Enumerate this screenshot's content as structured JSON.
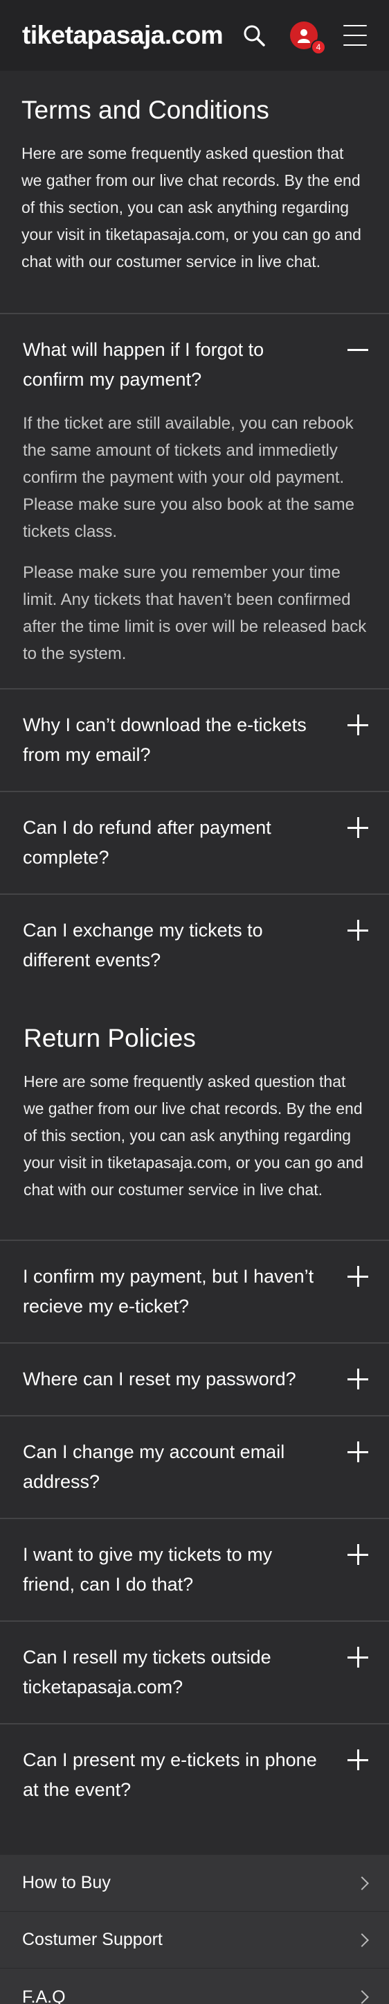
{
  "header": {
    "logo": "tiketapasaja.com",
    "notification_count": "4",
    "icons": {
      "search": "search-icon",
      "avatar": "user-avatar-icon",
      "menu": "hamburger-menu-icon"
    }
  },
  "terms": {
    "title": "Terms and Conditions",
    "description": "Here are some frequently asked question that we gather from our live chat records. By the end of this section, you can ask anything regarding your visit in tiketapasaja.com, or you can go and chat with our costumer service in live chat.",
    "faqs": [
      {
        "question": "What will happen if I forgot to confirm my payment?",
        "expanded": true,
        "answer": [
          "If the ticket are still available, you can rebook the same amount of tickets and immedietly confirm the payment with your old payment. Please make sure you also book at the same tickets class.",
          "Please make sure you remember your time limit. Any tickets that haven’t been confirmed after the time limit is over will be released back to the system."
        ]
      },
      {
        "question": "Why I can’t download the e-tickets from my email?",
        "expanded": false
      },
      {
        "question": "Can I do refund after payment complete?",
        "expanded": false
      },
      {
        "question": "Can I exchange my tickets to different events?",
        "expanded": false
      }
    ]
  },
  "returns": {
    "title": "Return Policies",
    "description": "Here are some frequently asked question that we gather from our live chat records. By the end of this section, you can ask anything regarding your visit in tiketapasaja.com, or you can go and chat with our costumer service in live chat.",
    "faqs": [
      {
        "question": "I confirm my payment, but I haven’t recieve my e-ticket?",
        "expanded": false
      },
      {
        "question": "Where can I reset my password?",
        "expanded": false
      },
      {
        "question": "Can I change my account email address?",
        "expanded": false
      },
      {
        "question": "I want to give my tickets to my friend, can I do that?",
        "expanded": false
      },
      {
        "question": "Can I resell my tickets outside ticketapasaja.com?",
        "expanded": false
      },
      {
        "question": "Can I present my e-tickets in phone at the event?",
        "expanded": false
      }
    ]
  },
  "footer": {
    "items": [
      {
        "label": "How to Buy"
      },
      {
        "label": "Costumer Support"
      },
      {
        "label": "F.A.Q"
      }
    ]
  },
  "colors": {
    "background": "#2b2b2d",
    "header": "#232325",
    "footer": "#363638",
    "accent_red": "#d32024"
  }
}
